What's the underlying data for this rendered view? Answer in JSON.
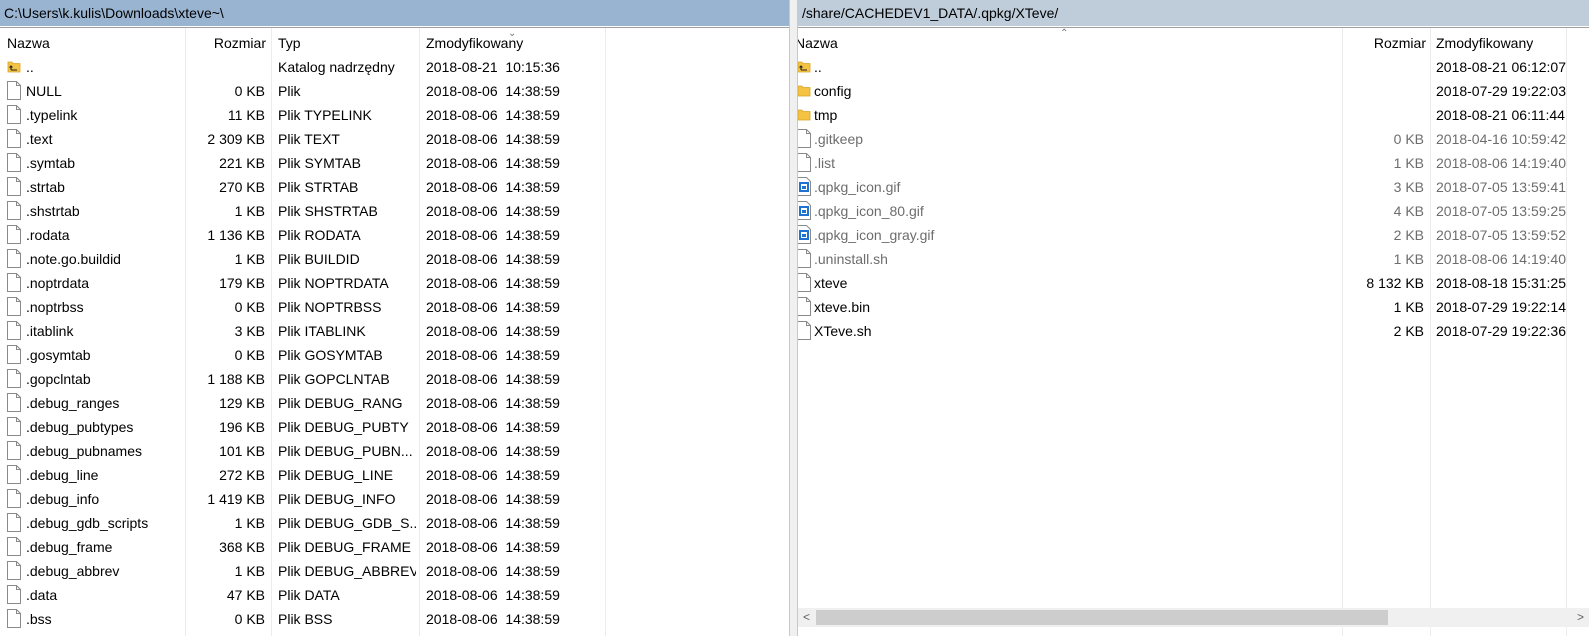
{
  "left": {
    "path": "C:\\Users\\k.kulis\\Downloads\\xteve~\\",
    "columns": {
      "name": "Nazwa",
      "size": "Rozmiar",
      "type": "Typ",
      "modified": "Zmodyfikowany"
    },
    "rows": [
      {
        "icon": "parent-folder-icon",
        "name": "..",
        "size": "",
        "type": "Katalog nadrzędny",
        "modified": "2018-08-21  10:15:36"
      },
      {
        "icon": "file-icon",
        "name": "NULL",
        "size": "0 KB",
        "type": "Plik",
        "modified": "2018-08-06  14:38:59"
      },
      {
        "icon": "file-icon",
        "name": ".typelink",
        "size": "11 KB",
        "type": "Plik TYPELINK",
        "modified": "2018-08-06  14:38:59"
      },
      {
        "icon": "file-icon",
        "name": ".text",
        "size": "2 309 KB",
        "type": "Plik TEXT",
        "modified": "2018-08-06  14:38:59"
      },
      {
        "icon": "file-icon",
        "name": ".symtab",
        "size": "221 KB",
        "type": "Plik SYMTAB",
        "modified": "2018-08-06  14:38:59"
      },
      {
        "icon": "file-icon",
        "name": ".strtab",
        "size": "270 KB",
        "type": "Plik STRTAB",
        "modified": "2018-08-06  14:38:59"
      },
      {
        "icon": "file-icon",
        "name": ".shstrtab",
        "size": "1 KB",
        "type": "Plik SHSTRTAB",
        "modified": "2018-08-06  14:38:59"
      },
      {
        "icon": "file-icon",
        "name": ".rodata",
        "size": "1 136 KB",
        "type": "Plik RODATA",
        "modified": "2018-08-06  14:38:59"
      },
      {
        "icon": "file-icon",
        "name": ".note.go.buildid",
        "size": "1 KB",
        "type": "Plik BUILDID",
        "modified": "2018-08-06  14:38:59"
      },
      {
        "icon": "file-icon",
        "name": ".noptrdata",
        "size": "179 KB",
        "type": "Plik NOPTRDATA",
        "modified": "2018-08-06  14:38:59"
      },
      {
        "icon": "file-icon",
        "name": ".noptrbss",
        "size": "0 KB",
        "type": "Plik NOPTRBSS",
        "modified": "2018-08-06  14:38:59"
      },
      {
        "icon": "file-icon",
        "name": ".itablink",
        "size": "3 KB",
        "type": "Plik ITABLINK",
        "modified": "2018-08-06  14:38:59"
      },
      {
        "icon": "file-icon",
        "name": ".gosymtab",
        "size": "0 KB",
        "type": "Plik GOSYMTAB",
        "modified": "2018-08-06  14:38:59"
      },
      {
        "icon": "file-icon",
        "name": ".gopclntab",
        "size": "1 188 KB",
        "type": "Plik GOPCLNTAB",
        "modified": "2018-08-06  14:38:59"
      },
      {
        "icon": "file-icon",
        "name": ".debug_ranges",
        "size": "129 KB",
        "type": "Plik DEBUG_RANG",
        "modified": "2018-08-06  14:38:59"
      },
      {
        "icon": "file-icon",
        "name": ".debug_pubtypes",
        "size": "196 KB",
        "type": "Plik DEBUG_PUBTY",
        "modified": "2018-08-06  14:38:59"
      },
      {
        "icon": "file-icon",
        "name": ".debug_pubnames",
        "size": "101 KB",
        "type": "Plik DEBUG_PUBN...",
        "modified": "2018-08-06  14:38:59"
      },
      {
        "icon": "file-icon",
        "name": ".debug_line",
        "size": "272 KB",
        "type": "Plik DEBUG_LINE",
        "modified": "2018-08-06  14:38:59"
      },
      {
        "icon": "file-icon",
        "name": ".debug_info",
        "size": "1 419 KB",
        "type": "Plik DEBUG_INFO",
        "modified": "2018-08-06  14:38:59"
      },
      {
        "icon": "file-icon",
        "name": ".debug_gdb_scripts",
        "size": "1 KB",
        "type": "Plik DEBUG_GDB_S...",
        "modified": "2018-08-06  14:38:59"
      },
      {
        "icon": "file-icon",
        "name": ".debug_frame",
        "size": "368 KB",
        "type": "Plik DEBUG_FRAME",
        "modified": "2018-08-06  14:38:59"
      },
      {
        "icon": "file-icon",
        "name": ".debug_abbrev",
        "size": "1 KB",
        "type": "Plik DEBUG_ABBREV",
        "modified": "2018-08-06  14:38:59"
      },
      {
        "icon": "file-icon",
        "name": ".data",
        "size": "47 KB",
        "type": "Plik DATA",
        "modified": "2018-08-06  14:38:59"
      },
      {
        "icon": "file-icon",
        "name": ".bss",
        "size": "0 KB",
        "type": "Plik BSS",
        "modified": "2018-08-06  14:38:59"
      }
    ]
  },
  "right": {
    "path": "/share/CACHEDEV1_DATA/.qpkg/XTeve/",
    "columns": {
      "name": "Nazwa",
      "size": "Rozmiar",
      "modified": "Zmodyfikowany"
    },
    "rows": [
      {
        "icon": "parent-folder-icon",
        "name": "..",
        "size": "",
        "modified": "2018-08-21 06:12:07",
        "dim": false
      },
      {
        "icon": "folder-icon",
        "name": "config",
        "size": "",
        "modified": "2018-07-29 19:22:03",
        "dim": false
      },
      {
        "icon": "folder-icon",
        "name": "tmp",
        "size": "",
        "modified": "2018-08-21 06:11:44",
        "dim": false
      },
      {
        "icon": "file-icon",
        "name": ".gitkeep",
        "size": "0 KB",
        "modified": "2018-04-16 10:59:42",
        "dim": true
      },
      {
        "icon": "file-icon",
        "name": ".list",
        "size": "1 KB",
        "modified": "2018-08-06 14:19:40",
        "dim": true
      },
      {
        "icon": "image-file-icon",
        "name": ".qpkg_icon.gif",
        "size": "3 KB",
        "modified": "2018-07-05 13:59:41",
        "dim": true
      },
      {
        "icon": "image-file-icon",
        "name": ".qpkg_icon_80.gif",
        "size": "4 KB",
        "modified": "2018-07-05 13:59:25",
        "dim": true
      },
      {
        "icon": "image-file-icon",
        "name": ".qpkg_icon_gray.gif",
        "size": "2 KB",
        "modified": "2018-07-05 13:59:52",
        "dim": true
      },
      {
        "icon": "file-icon",
        "name": ".uninstall.sh",
        "size": "1 KB",
        "modified": "2018-08-06 14:19:40",
        "dim": true
      },
      {
        "icon": "file-icon",
        "name": "xteve",
        "size": "8 132 KB",
        "modified": "2018-08-18 15:31:25",
        "dim": false
      },
      {
        "icon": "file-icon",
        "name": "xteve.bin",
        "size": "1 KB",
        "modified": "2018-07-29 19:22:14",
        "dim": false
      },
      {
        "icon": "file-icon",
        "name": "XTeve.sh",
        "size": "2 KB",
        "modified": "2018-07-29 19:22:36",
        "dim": false
      }
    ],
    "scrollbar": {
      "left_arrow": "<",
      "right_arrow": ">"
    }
  },
  "colors": {
    "active_path_bg": "#99b4d1",
    "inactive_path_bg": "#bfcddb",
    "dim_text": "#6d6d6d",
    "folder": "#f5c342"
  }
}
